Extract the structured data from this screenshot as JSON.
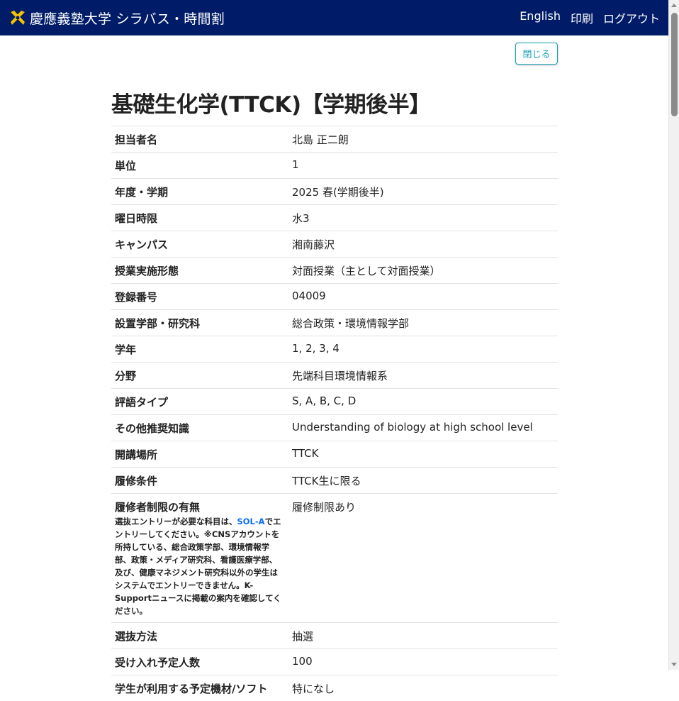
{
  "header": {
    "title": "慶應義塾大学 シラバス・時間割",
    "links": [
      "English",
      "印刷",
      "ログアウト"
    ],
    "bg_color": "#001c68",
    "logo_color": "#f2c400"
  },
  "close_button": "閉じる",
  "course_title": "基礎生化学(TTCK)【学期後半】",
  "rows": [
    {
      "label": "担当者名",
      "value": "北島 正二朗"
    },
    {
      "label": "単位",
      "value": "1"
    },
    {
      "label": "年度・学期",
      "value": "2025 春(学期後半)"
    },
    {
      "label": "曜日時限",
      "value": "水3"
    },
    {
      "label": "キャンパス",
      "value": "湘南藤沢"
    },
    {
      "label": "授業実施形態",
      "value": "対面授業（主として対面授業）"
    },
    {
      "label": "登録番号",
      "value": "04009"
    },
    {
      "label": "設置学部・研究科",
      "value": "総合政策・環境情報学部"
    },
    {
      "label": "学年",
      "value": "1, 2, 3, 4"
    },
    {
      "label": "分野",
      "value": "先端科目環境情報系"
    },
    {
      "label": "評語タイプ",
      "value": "S, A, B, C, D"
    },
    {
      "label": "その他推奨知識",
      "value": "Understanding of biology at high school level"
    },
    {
      "label": "開講場所",
      "value": "TTCK"
    },
    {
      "label": "履修条件",
      "value": "TTCK生に限る"
    }
  ],
  "restriction": {
    "label": "履修者制限の有無",
    "note_before": "選抜エントリーが必要な科目は、",
    "note_link": "SOL-A",
    "note_after": "でエントリーしてください。※CNSアカウントを所持している、総合政策学部、環境情報学部、政策・メディア研究科、看護医療学部、及び、健康マネジメント研究科以外の学生はシステムでエントリーできません。K-Supportニュースに掲載の案内を確認してください。",
    "value": "履修制限あり"
  },
  "rows_after": [
    {
      "label": "選抜方法",
      "value": "抽選"
    },
    {
      "label": "受け入れ予定人数",
      "value": "100"
    },
    {
      "label": "学生が利用する予定機材/ソフト",
      "value": "特になし"
    }
  ]
}
